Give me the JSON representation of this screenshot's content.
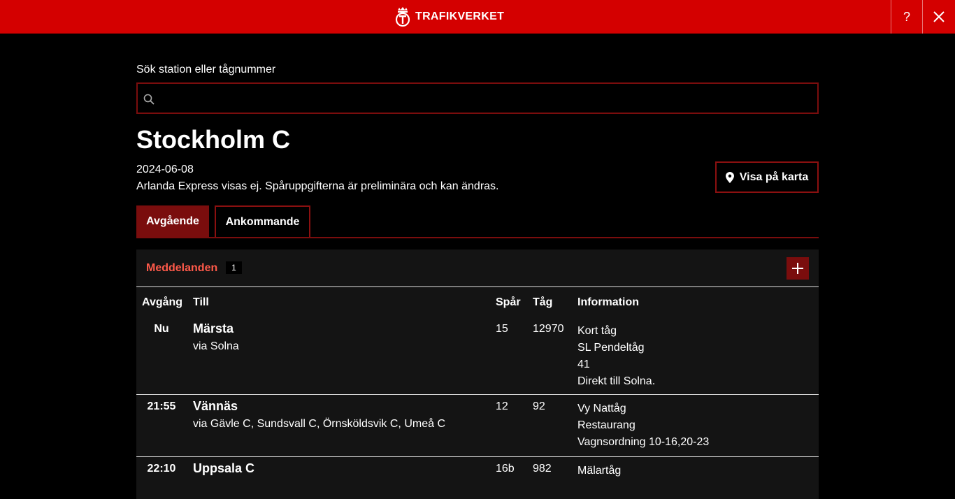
{
  "header": {
    "brand": "TRAFIKVERKET",
    "help_label": "?"
  },
  "search": {
    "label": "Sök station eller tågnummer",
    "value": "",
    "placeholder": ""
  },
  "station": {
    "name": "Stockholm C",
    "date": "2024-06-08",
    "notice": "Arlanda Express visas ej. Spåruppgifterna är preliminära och kan ändras.",
    "map_button": "Visa på karta"
  },
  "tabs": [
    {
      "label": "Avgående",
      "active": true
    },
    {
      "label": "Ankommande",
      "active": false
    }
  ],
  "messages": {
    "label": "Meddelanden",
    "count": "1"
  },
  "table": {
    "headers": {
      "departure": "Avgång",
      "to": "Till",
      "track": "Spår",
      "train": "Tåg",
      "info": "Information"
    },
    "rows": [
      {
        "time": "Nu",
        "destination": "Märsta",
        "via": "via Solna",
        "track": "15",
        "train": "12970",
        "info": [
          "Kort tåg",
          "SL Pendeltåg",
          "41",
          "Direkt till Solna."
        ]
      },
      {
        "time": "21:55",
        "destination": "Vännäs",
        "via": "via Gävle C, Sundsvall C, Örnsköldsvik C, Umeå C",
        "track": "12",
        "train": "92",
        "info": [
          "Vy Nattåg",
          "Restaurang",
          "Vagnsordning 10-16,20-23"
        ]
      },
      {
        "time": "22:10",
        "destination": "Uppsala C",
        "via": "",
        "track": "16b",
        "train": "982",
        "info": [
          "Mälartåg"
        ]
      }
    ]
  },
  "colors": {
    "brand_red": "#d40000",
    "accent_dark_red": "#7a0d0d",
    "message_red": "#ff5a4a"
  }
}
